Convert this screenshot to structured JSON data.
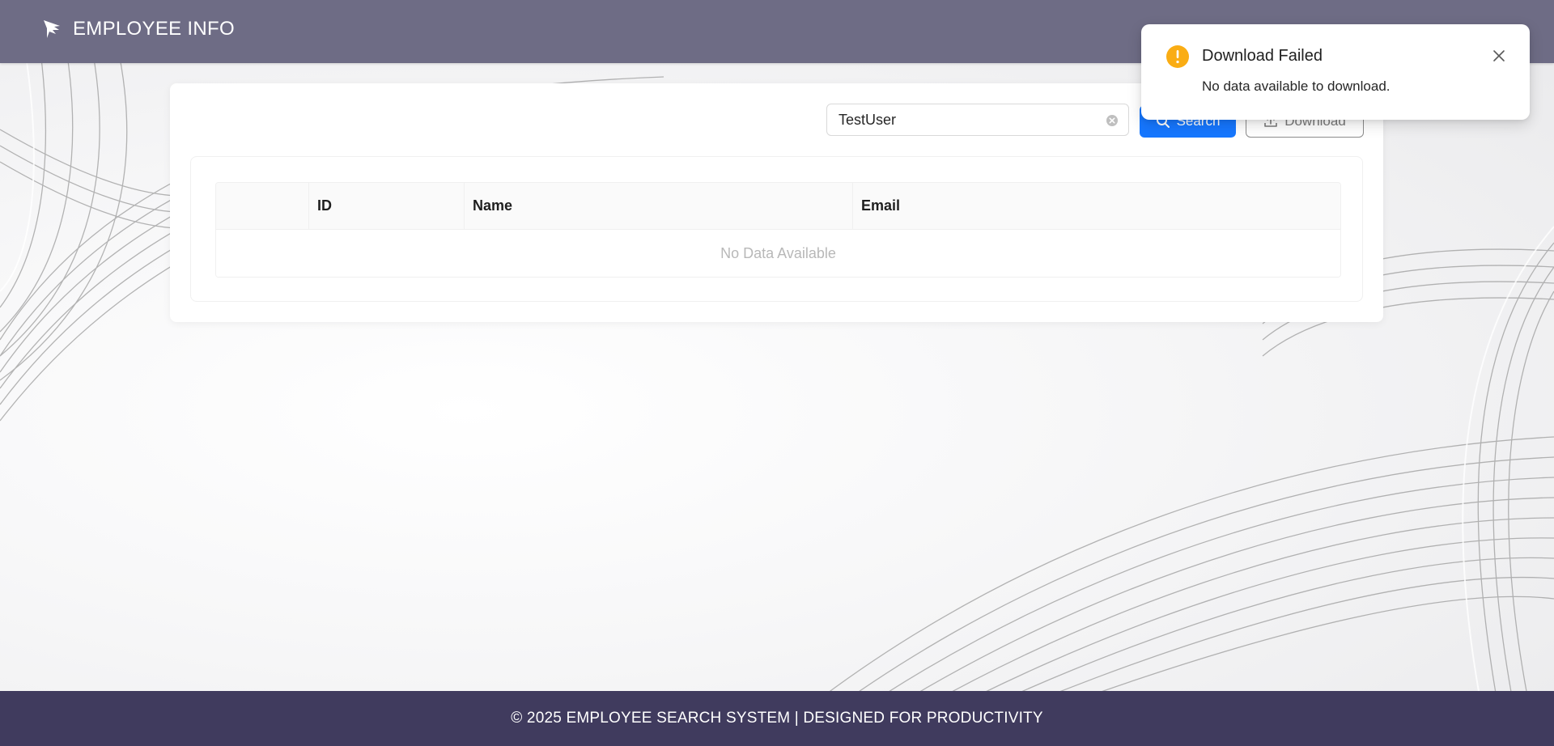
{
  "header": {
    "title": "EMPLOYEE INFO",
    "logo_icon": "bird-logo-icon"
  },
  "search": {
    "value": "TestUser",
    "clear_icon": "clear-circle-icon"
  },
  "toolbar": {
    "search_label": "Search",
    "search_icon": "search-icon",
    "download_label": "Download",
    "download_icon": "upload-tray-icon"
  },
  "table": {
    "columns": [
      "",
      "ID",
      "Name",
      "Email"
    ],
    "empty_text": "No Data Available"
  },
  "notification": {
    "title": "Download Failed",
    "message": "No data available to download.",
    "icon": "warning-circle-icon",
    "close_icon": "close-icon"
  },
  "footer": {
    "text": "© 2025 EMPLOYEE SEARCH SYSTEM | DESIGNED FOR PRODUCTIVITY"
  },
  "colors": {
    "header_bg": "#6e6c85",
    "footer_bg": "#403b5e",
    "primary": "#1677ff",
    "warning": "#faad14"
  }
}
